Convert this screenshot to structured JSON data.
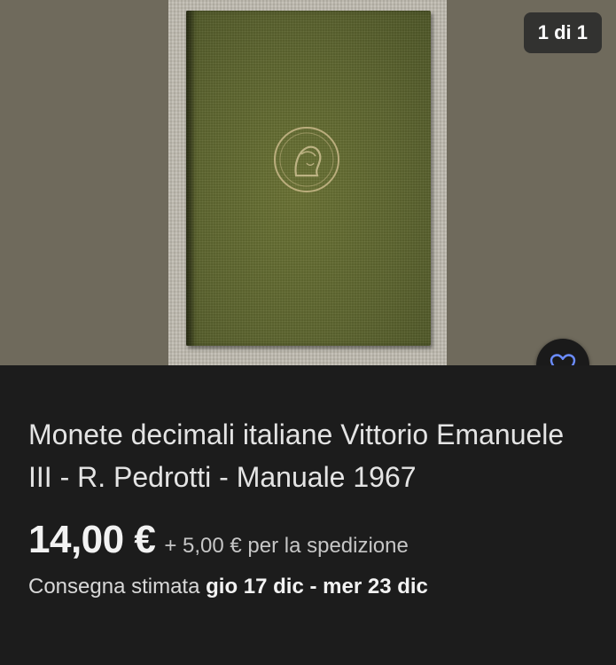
{
  "gallery": {
    "counter": "1 di 1"
  },
  "favorite": {
    "icon": "heart-outline-icon",
    "color": "#6b8cff"
  },
  "listing": {
    "title": "Monete decimali italiane Vittorio Emanuele III - R. Pedrotti - Manuale 1967",
    "price": "14,00 €",
    "shipping": "+ 5,00 € per la spedizione",
    "delivery_label": "Consegna stimata",
    "delivery_range": "gio 17 dic - mer 23 dic"
  },
  "colors": {
    "background": "#1c1c1c",
    "book_cover": "#5e6630"
  }
}
